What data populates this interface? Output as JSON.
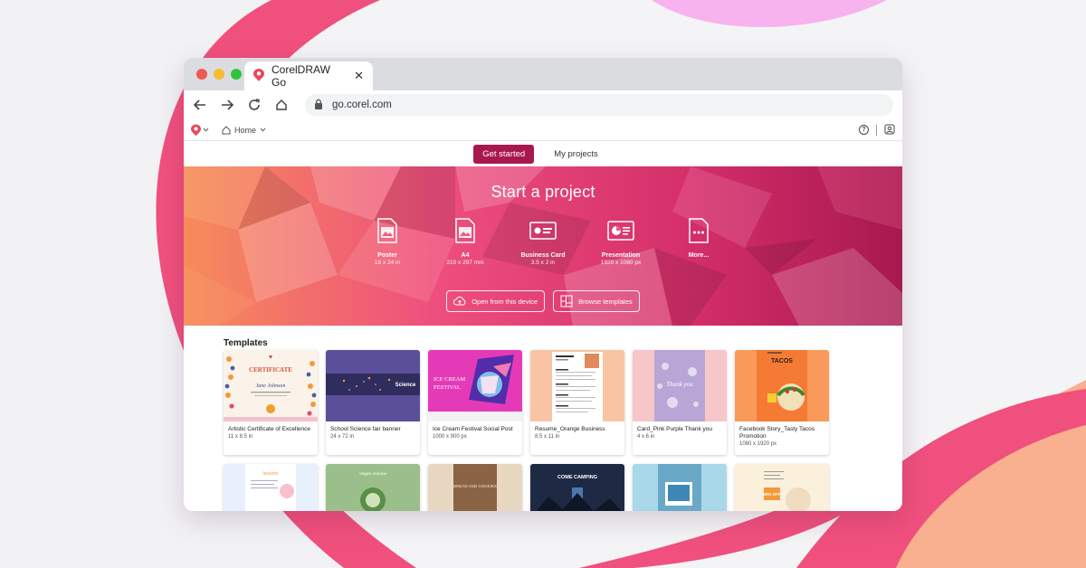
{
  "window": {
    "tab_title": "CorelDRAW Go",
    "close_glyph": "✕",
    "traffic_lights": [
      "#ee5a52",
      "#f4be2e",
      "#2fc53f"
    ]
  },
  "toolbar": {
    "url": "go.corel.com"
  },
  "appbar": {
    "home_label": "Home",
    "help_glyph": "?"
  },
  "page_tabs": {
    "get_started": "Get started",
    "my_projects": "My projects"
  },
  "hero": {
    "title": "Start a project",
    "project_types": [
      {
        "label": "Poster",
        "size": "18 x 24 in",
        "icon": "poster-icon"
      },
      {
        "label": "A4",
        "size": "210 x 297 mm",
        "icon": "a4-icon"
      },
      {
        "label": "Business Card",
        "size": "3.5 x 2 in",
        "icon": "business-card-icon"
      },
      {
        "label": "Presentation",
        "size": "1920 x 1080 px",
        "icon": "presentation-icon"
      },
      {
        "label": "More...",
        "size": "",
        "icon": "more-icon"
      }
    ],
    "open_device": "Open from this device",
    "browse_templates": "Browse templates"
  },
  "templates": {
    "heading": "Templates",
    "cards": [
      {
        "name": "Artistic Certificate of Excellence",
        "size": "11 x 8.5 in",
        "thumb_text": [
          "CERTIFICATE",
          "Jane Johnson"
        ]
      },
      {
        "name": "School Science fair banner",
        "size": "24 x 72 in",
        "thumb_text": [
          "Science"
        ]
      },
      {
        "name": "Ice Cream Festival Social Post",
        "size": "1000 x 900 px",
        "thumb_text": [
          "ICE CREAM",
          "FESTIVAL"
        ]
      },
      {
        "name": "Resume_Orange Business",
        "size": "8.5 x 11 in",
        "thumb_text": []
      },
      {
        "name": "Card_Pink Purple Thank you",
        "size": "4 x 6 in",
        "thumb_text": [
          "Thank you"
        ]
      },
      {
        "name": "Facebook Story_Tasty Tacos Promotion",
        "size": "1080 x 1920 px",
        "thumb_text": [
          "TACOS"
        ]
      }
    ],
    "row2_thumb_text": [
      "",
      "vegan cuisine",
      "BREAD AND COOKIES",
      "COME CAMPING",
      "",
      "20% OFF"
    ]
  },
  "colors": {
    "brand": "#a8184f",
    "hero_left": "#f58a5c",
    "hero_right": "#a8184f"
  }
}
